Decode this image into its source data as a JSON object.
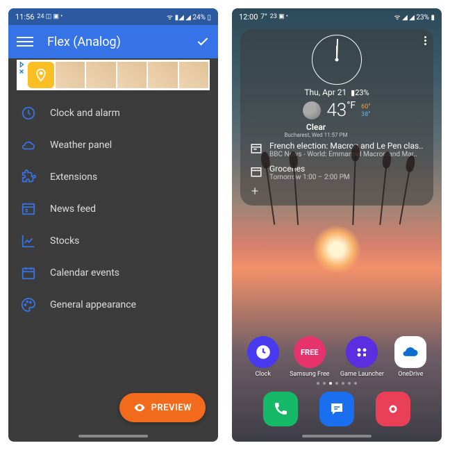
{
  "phone1": {
    "status": {
      "time": "11:56",
      "icons": "24 ◫ ▣ •",
      "right": "ᯤ ▮◢ ◢ 24% ▯"
    },
    "appbar": {
      "title": "Flex (Analog)"
    },
    "menu": [
      {
        "icon": "clock",
        "label": "Clock and alarm"
      },
      {
        "icon": "cloud",
        "label": "Weather panel"
      },
      {
        "icon": "puzzle",
        "label": "Extensions"
      },
      {
        "icon": "news",
        "label": "News feed"
      },
      {
        "icon": "chart",
        "label": "Stocks"
      },
      {
        "icon": "calendar",
        "label": "Calendar events"
      },
      {
        "icon": "palette",
        "label": "General appearance"
      }
    ],
    "preview_label": "PREVIEW"
  },
  "phone2": {
    "status": {
      "time": "12:00",
      "temp": "7°",
      "icons": "23 ▣ •",
      "right": "ᯤ ◢ ◢ 23% ▮"
    },
    "widget": {
      "date": "Thu, Apr 21",
      "battery": "▮23%",
      "temp": "43",
      "unit": "°F",
      "hi": "60",
      "lo": "38",
      "cond": "Clear",
      "loc": "Bucharest, Wed 11:57 PM",
      "news_title": "French election: Macron and Le Pen clas..",
      "news_sub": "BBC News - World: Emmanuel Macron and Mar..",
      "event_title": "Groceries",
      "event_sub": "Tomorrow 1:00 – 2:00 PM"
    },
    "apps": [
      {
        "label": "Clock",
        "bg": "#4a3aef"
      },
      {
        "label": "Samsung Free",
        "bg": "#e6336b",
        "txt": "FREE"
      },
      {
        "label": "Game Launcher",
        "bg": "#5b2ee0"
      },
      {
        "label": "OneDrive",
        "bg": "#ffffff"
      }
    ],
    "dock": [
      {
        "name": "phone",
        "bg": "#16b967"
      },
      {
        "name": "messages",
        "bg": "#1a6ef0"
      },
      {
        "name": "camera",
        "bg": "#e94057"
      }
    ]
  }
}
